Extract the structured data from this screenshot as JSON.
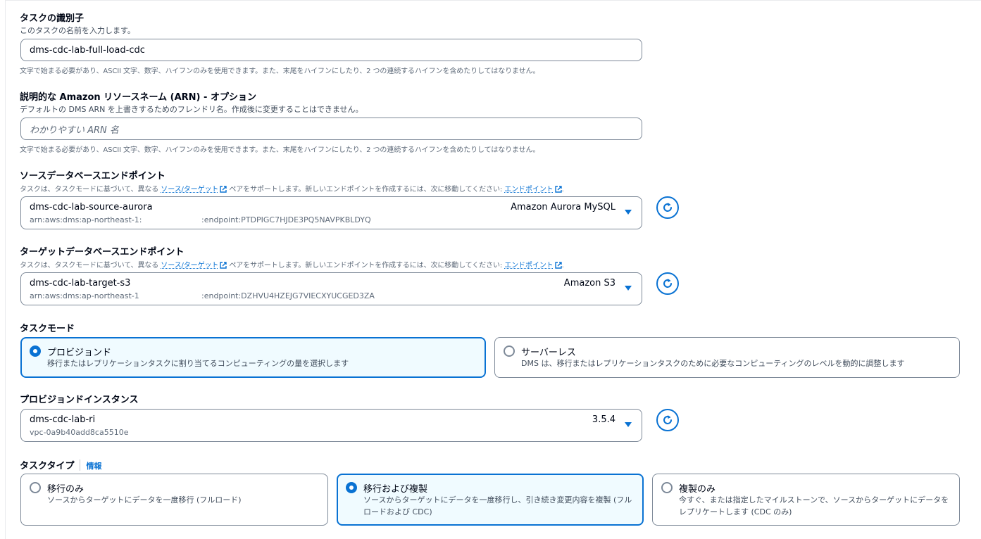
{
  "task_identifier": {
    "label": "タスクの識別子",
    "description": "このタスクの名前を入力します。",
    "value": "dms-cdc-lab-full-load-cdc",
    "hint": "文字で始まる必要があり、ASCII 文字、数字、ハイフンのみを使用できます。また、末尾をハイフンにしたり、2 つの連続するハイフンを含めたりしてはなりません。"
  },
  "arn_name": {
    "label": "説明的な Amazon リソースネーム (ARN) - オプション",
    "description": "デフォルトの DMS ARN を上書きするためのフレンドリ名。作成後に変更することはできません。",
    "placeholder": "わかりやすい ARN 名",
    "hint": "文字で始まる必要があり、ASCII 文字、数字、ハイフンのみを使用できます。また、末尾をハイフンにしたり、2 つの連続するハイフンを含めたりしてはなりません。"
  },
  "source_endpoint": {
    "label": "ソースデータベースエンドポイント",
    "desc_prefix": "タスクは、タスクモードに基づいて、異なる",
    "desc_link1": "ソース/ターゲット",
    "desc_middle": "ペアをサポートします。新しいエンドポイントを作成するには、次に移動してください:",
    "desc_link2": "エンドポイント",
    "desc_suffix": ".",
    "selected_name": "dms-cdc-lab-source-aurora",
    "selected_engine": "Amazon Aurora MySQL",
    "arn_prefix": "arn:aws:dms:ap-northeast-1:",
    "arn_suffix": ":endpoint:PTDPIGC7HJDE3PQ5NAVPKBLDYQ"
  },
  "target_endpoint": {
    "label": "ターゲットデータベースエンドポイント",
    "desc_prefix": "タスクは、タスクモードに基づいて、異なる",
    "desc_link1": "ソース/ターゲット",
    "desc_middle": "ペアをサポートします。新しいエンドポイントを作成するには、次に移動してください:",
    "desc_link2": "エンドポイント",
    "desc_suffix": ".",
    "selected_name": "dms-cdc-lab-target-s3",
    "selected_engine": "Amazon S3",
    "arn_prefix": "arn:aws:dms:ap-northeast-1",
    "arn_suffix": ":endpoint:DZHVU4HZEJG7VIECXYUCGED3ZA"
  },
  "task_mode": {
    "label": "タスクモード",
    "options": [
      {
        "title": "プロビジョンド",
        "description": "移行またはレプリケーションタスクに割り当てるコンピューティングの量を選択します",
        "selected": true
      },
      {
        "title": "サーバーレス",
        "description": "DMS は、移行またはレプリケーションタスクのために必要なコンピューティングのレベルを動的に調整します",
        "selected": false
      }
    ]
  },
  "provisioned_instance": {
    "label": "プロビジョンドインスタンス",
    "selected_name": "dms-cdc-lab-ri",
    "selected_version": "3.5.4",
    "selected_sub": "vpc-0a9b40add8ca5510e"
  },
  "task_type": {
    "label": "タスクタイプ",
    "info": "情報",
    "options": [
      {
        "title": "移行のみ",
        "description": "ソースからターゲットにデータを一度移行 (フルロード)",
        "selected": false
      },
      {
        "title": "移行および複製",
        "description": "ソースからターゲットにデータを一度移行し、引き続き変更内容を複製 (フルロードおよび CDC)",
        "selected": true
      },
      {
        "title": "複製のみ",
        "description": "今すぐ、または指定したマイルストーンで、ソースからターゲットにデータをレプリケートします (CDC のみ)",
        "selected": false
      }
    ]
  },
  "colors": {
    "accent": "#0972d3",
    "selected_bg": "#f0fbff",
    "border": "#7d8998",
    "text": "#000716"
  }
}
